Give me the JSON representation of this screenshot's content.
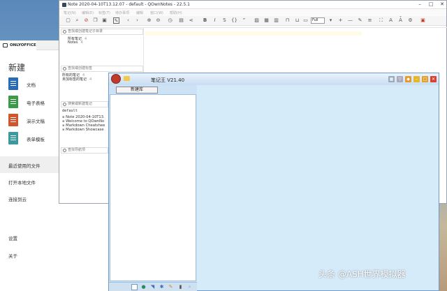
{
  "onlyoffice": {
    "tab_label": "ONLYOFFICE",
    "section_title": "新建",
    "create_items": [
      {
        "label": "文档",
        "color": "#2a6bb5"
      },
      {
        "label": "电子表格",
        "color": "#3a9a46"
      },
      {
        "label": "演示文稿",
        "color": "#d2562c"
      },
      {
        "label": "表单模板",
        "color": "#3a9aa0"
      }
    ],
    "recent_label": "最近使用的文件",
    "open_local_label": "打开本地文件",
    "connect_cloud_label": "连接到云",
    "settings_label": "设置",
    "about_label": "关于"
  },
  "qownnotes": {
    "title": "Note 2020-04-10T13.12.07 - default - QOwnNotes - 22.5.1",
    "menu": [
      "笔记(N)",
      "编辑(E)",
      "标签(T)",
      "待办事项",
      "编辑",
      "窗口(W)",
      "帮助(H)"
    ],
    "subfolder_search_placeholder": "查找或创建笔记子目录",
    "subfolders": [
      {
        "label": "所有笔记",
        "count": "4"
      },
      {
        "label": "Notes",
        "count": "4"
      }
    ],
    "tag_search_placeholder": "查找或创建标签",
    "tags": [
      {
        "label": "所有的笔记",
        "count": "4"
      },
      {
        "label": "未加标签的笔记",
        "count": "4"
      }
    ],
    "note_search_placeholder": "搜索或新建笔记",
    "folder_label": "default",
    "notes": [
      "Note 2020-04-10T13.",
      "Welcome to QOwnNo",
      "Markdown Cheatshee",
      "Markdown Showcase"
    ],
    "nav_search_placeholder": "查找导航项",
    "font_select": "Full"
  },
  "bijiwang": {
    "title": "笔记王 V21.40",
    "new_library_button": "新建库"
  },
  "watermark": "头条 @ASH世界模拟器"
}
